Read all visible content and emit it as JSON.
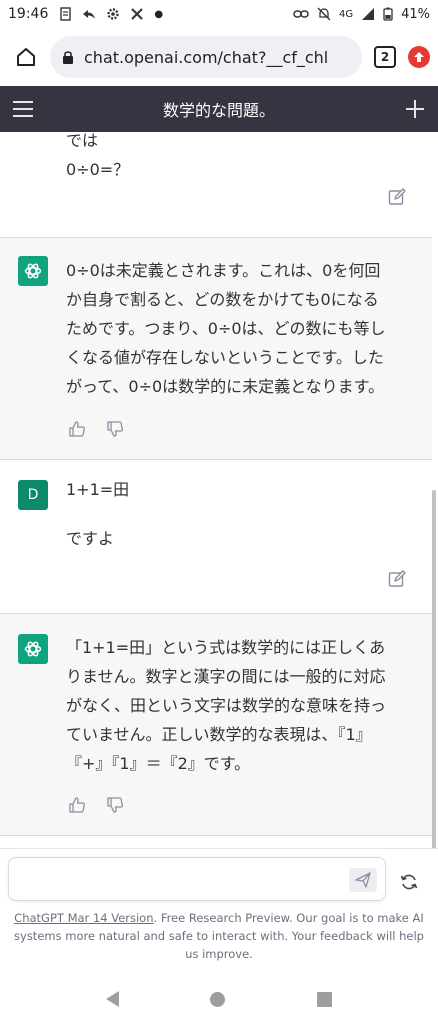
{
  "status_bar": {
    "time": "19:46",
    "network": "4G",
    "battery": "41%"
  },
  "browser": {
    "url": "chat.openai.com/chat?__cf_chl",
    "tab_count": "2"
  },
  "header": {
    "title": "数学的な問題。"
  },
  "messages": [
    {
      "role": "user",
      "avatar_letter": "",
      "lines": [
        "では",
        "0÷0=？"
      ]
    },
    {
      "role": "assistant",
      "lines": [
        "0÷0は未定義とされます。これは、0を何回",
        "か自身で割ると、どの数をかけても0になる",
        "ためです。つまり、0÷0は、どの数にも等し",
        "くなる値が存在しないということです。した",
        "がって、0÷0は数学的に未定義となります。"
      ]
    },
    {
      "role": "user",
      "avatar_letter": "D",
      "lines": [
        "1+1=田",
        "",
        "ですよ"
      ]
    },
    {
      "role": "assistant",
      "lines": [
        "「1+1=田」という式は数学的には正しくあ",
        "りません。数字と漢字の間には一般的に対応",
        "がなく、田という文字は数学的な意味を持っ",
        "ていません。正しい数学的な表現は、『1』",
        "『+』『1』＝『2』です。"
      ]
    }
  ],
  "composer": {
    "placeholder": ""
  },
  "footer": {
    "link_text": "ChatGPT Mar 14 Version",
    "text": ". Free Research Preview. Our goal is to make AI systems more natural and safe to interact with. Your feedback will help us improve."
  },
  "colors": {
    "header_bg": "#343541",
    "assistant_bg": "#f7f7f8",
    "gpt_green": "#10a37f",
    "user_avatar": "#0d8a6a"
  }
}
